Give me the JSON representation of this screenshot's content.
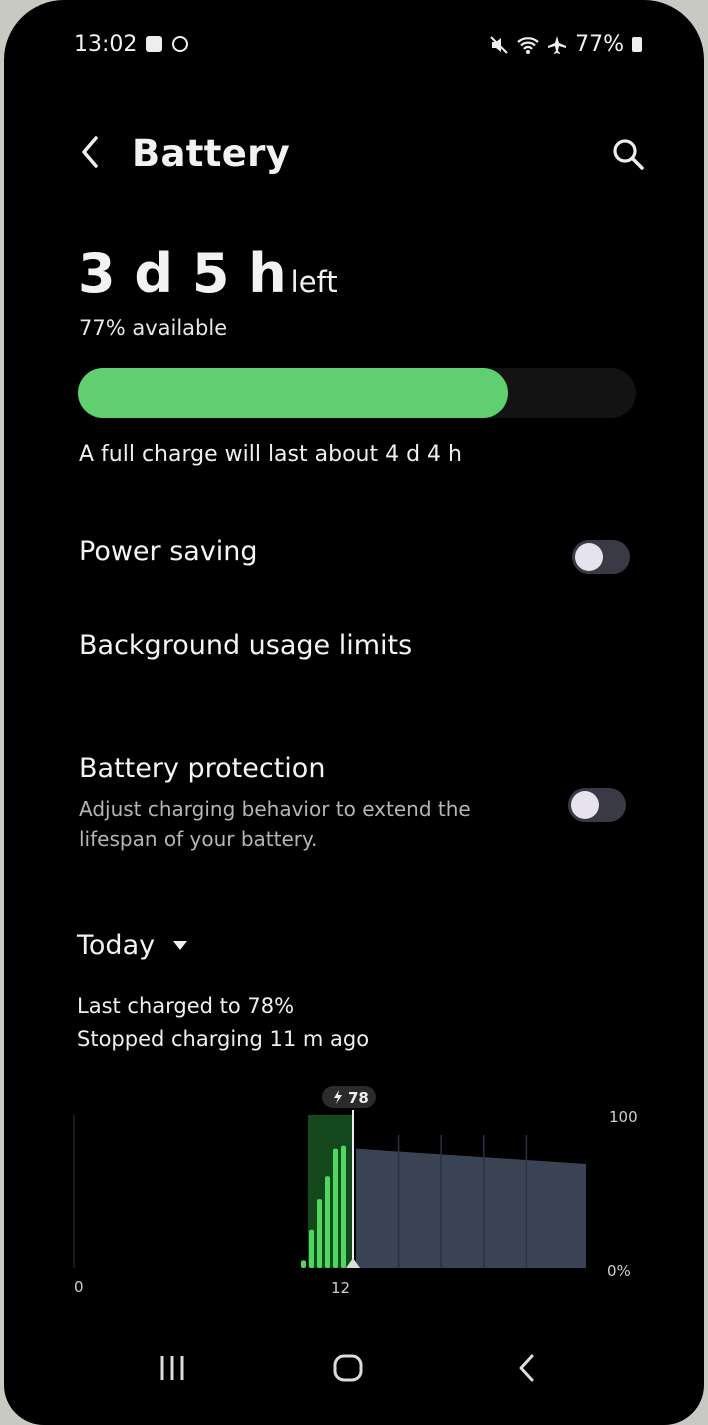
{
  "status_bar": {
    "time": "13:02",
    "battery_percent": "77%",
    "notification_icons": [
      "message-icon",
      "circle-icon"
    ],
    "system_icons": [
      "mute-icon",
      "wifi-icon",
      "airplane-icon",
      "battery-icon"
    ]
  },
  "header": {
    "title": "Battery"
  },
  "battery": {
    "time_left": "3 d 5 h",
    "left_word": "left",
    "available": "77% available",
    "level_fraction": 0.77,
    "full_charge": "A full charge will last about 4 d 4 h",
    "bar_color": "#5fcf72"
  },
  "settings": {
    "power_saving": {
      "label": "Power saving",
      "on": false
    },
    "background_limits": {
      "label": "Background usage limits"
    },
    "battery_protection": {
      "label": "Battery protection",
      "description": "Adjust charging behavior to extend the lifespan of your battery.",
      "on": false
    }
  },
  "usage": {
    "period": "Today",
    "last_charged": "Last charged to 78%",
    "stopped": "Stopped charging 11 m ago"
  },
  "chart_data": {
    "type": "area",
    "marker_label": "78",
    "x_ticks": [
      "0",
      "12"
    ],
    "y_ticks": [
      "100",
      "0%"
    ],
    "charging_bars": [
      5,
      25,
      45,
      60,
      78,
      80
    ],
    "projected_start": 78,
    "projected_end": 68,
    "colors": {
      "charge": "#4fd861",
      "charge_bg": "#15471d",
      "projection": "#3a4354"
    }
  },
  "nav_bar": {
    "buttons": [
      "recents-button",
      "home-button",
      "back-button"
    ]
  }
}
